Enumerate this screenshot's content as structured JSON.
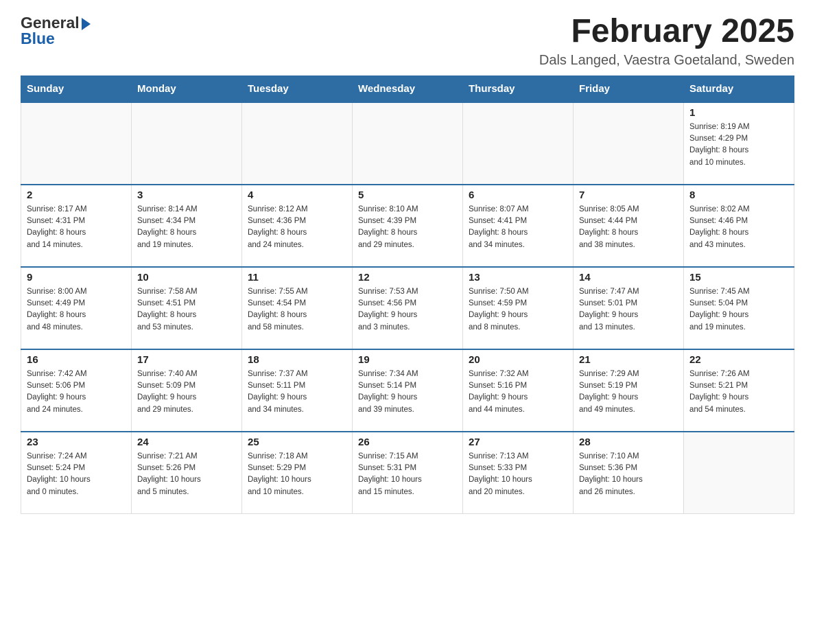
{
  "header": {
    "logo_general": "General",
    "logo_blue": "Blue",
    "month_title": "February 2025",
    "location": "Dals Langed, Vaestra Goetaland, Sweden"
  },
  "weekdays": [
    "Sunday",
    "Monday",
    "Tuesday",
    "Wednesday",
    "Thursday",
    "Friday",
    "Saturday"
  ],
  "weeks": [
    [
      {
        "day": "",
        "info": ""
      },
      {
        "day": "",
        "info": ""
      },
      {
        "day": "",
        "info": ""
      },
      {
        "day": "",
        "info": ""
      },
      {
        "day": "",
        "info": ""
      },
      {
        "day": "",
        "info": ""
      },
      {
        "day": "1",
        "info": "Sunrise: 8:19 AM\nSunset: 4:29 PM\nDaylight: 8 hours\nand 10 minutes."
      }
    ],
    [
      {
        "day": "2",
        "info": "Sunrise: 8:17 AM\nSunset: 4:31 PM\nDaylight: 8 hours\nand 14 minutes."
      },
      {
        "day": "3",
        "info": "Sunrise: 8:14 AM\nSunset: 4:34 PM\nDaylight: 8 hours\nand 19 minutes."
      },
      {
        "day": "4",
        "info": "Sunrise: 8:12 AM\nSunset: 4:36 PM\nDaylight: 8 hours\nand 24 minutes."
      },
      {
        "day": "5",
        "info": "Sunrise: 8:10 AM\nSunset: 4:39 PM\nDaylight: 8 hours\nand 29 minutes."
      },
      {
        "day": "6",
        "info": "Sunrise: 8:07 AM\nSunset: 4:41 PM\nDaylight: 8 hours\nand 34 minutes."
      },
      {
        "day": "7",
        "info": "Sunrise: 8:05 AM\nSunset: 4:44 PM\nDaylight: 8 hours\nand 38 minutes."
      },
      {
        "day": "8",
        "info": "Sunrise: 8:02 AM\nSunset: 4:46 PM\nDaylight: 8 hours\nand 43 minutes."
      }
    ],
    [
      {
        "day": "9",
        "info": "Sunrise: 8:00 AM\nSunset: 4:49 PM\nDaylight: 8 hours\nand 48 minutes."
      },
      {
        "day": "10",
        "info": "Sunrise: 7:58 AM\nSunset: 4:51 PM\nDaylight: 8 hours\nand 53 minutes."
      },
      {
        "day": "11",
        "info": "Sunrise: 7:55 AM\nSunset: 4:54 PM\nDaylight: 8 hours\nand 58 minutes."
      },
      {
        "day": "12",
        "info": "Sunrise: 7:53 AM\nSunset: 4:56 PM\nDaylight: 9 hours\nand 3 minutes."
      },
      {
        "day": "13",
        "info": "Sunrise: 7:50 AM\nSunset: 4:59 PM\nDaylight: 9 hours\nand 8 minutes."
      },
      {
        "day": "14",
        "info": "Sunrise: 7:47 AM\nSunset: 5:01 PM\nDaylight: 9 hours\nand 13 minutes."
      },
      {
        "day": "15",
        "info": "Sunrise: 7:45 AM\nSunset: 5:04 PM\nDaylight: 9 hours\nand 19 minutes."
      }
    ],
    [
      {
        "day": "16",
        "info": "Sunrise: 7:42 AM\nSunset: 5:06 PM\nDaylight: 9 hours\nand 24 minutes."
      },
      {
        "day": "17",
        "info": "Sunrise: 7:40 AM\nSunset: 5:09 PM\nDaylight: 9 hours\nand 29 minutes."
      },
      {
        "day": "18",
        "info": "Sunrise: 7:37 AM\nSunset: 5:11 PM\nDaylight: 9 hours\nand 34 minutes."
      },
      {
        "day": "19",
        "info": "Sunrise: 7:34 AM\nSunset: 5:14 PM\nDaylight: 9 hours\nand 39 minutes."
      },
      {
        "day": "20",
        "info": "Sunrise: 7:32 AM\nSunset: 5:16 PM\nDaylight: 9 hours\nand 44 minutes."
      },
      {
        "day": "21",
        "info": "Sunrise: 7:29 AM\nSunset: 5:19 PM\nDaylight: 9 hours\nand 49 minutes."
      },
      {
        "day": "22",
        "info": "Sunrise: 7:26 AM\nSunset: 5:21 PM\nDaylight: 9 hours\nand 54 minutes."
      }
    ],
    [
      {
        "day": "23",
        "info": "Sunrise: 7:24 AM\nSunset: 5:24 PM\nDaylight: 10 hours\nand 0 minutes."
      },
      {
        "day": "24",
        "info": "Sunrise: 7:21 AM\nSunset: 5:26 PM\nDaylight: 10 hours\nand 5 minutes."
      },
      {
        "day": "25",
        "info": "Sunrise: 7:18 AM\nSunset: 5:29 PM\nDaylight: 10 hours\nand 10 minutes."
      },
      {
        "day": "26",
        "info": "Sunrise: 7:15 AM\nSunset: 5:31 PM\nDaylight: 10 hours\nand 15 minutes."
      },
      {
        "day": "27",
        "info": "Sunrise: 7:13 AM\nSunset: 5:33 PM\nDaylight: 10 hours\nand 20 minutes."
      },
      {
        "day": "28",
        "info": "Sunrise: 7:10 AM\nSunset: 5:36 PM\nDaylight: 10 hours\nand 26 minutes."
      },
      {
        "day": "",
        "info": ""
      }
    ]
  ]
}
